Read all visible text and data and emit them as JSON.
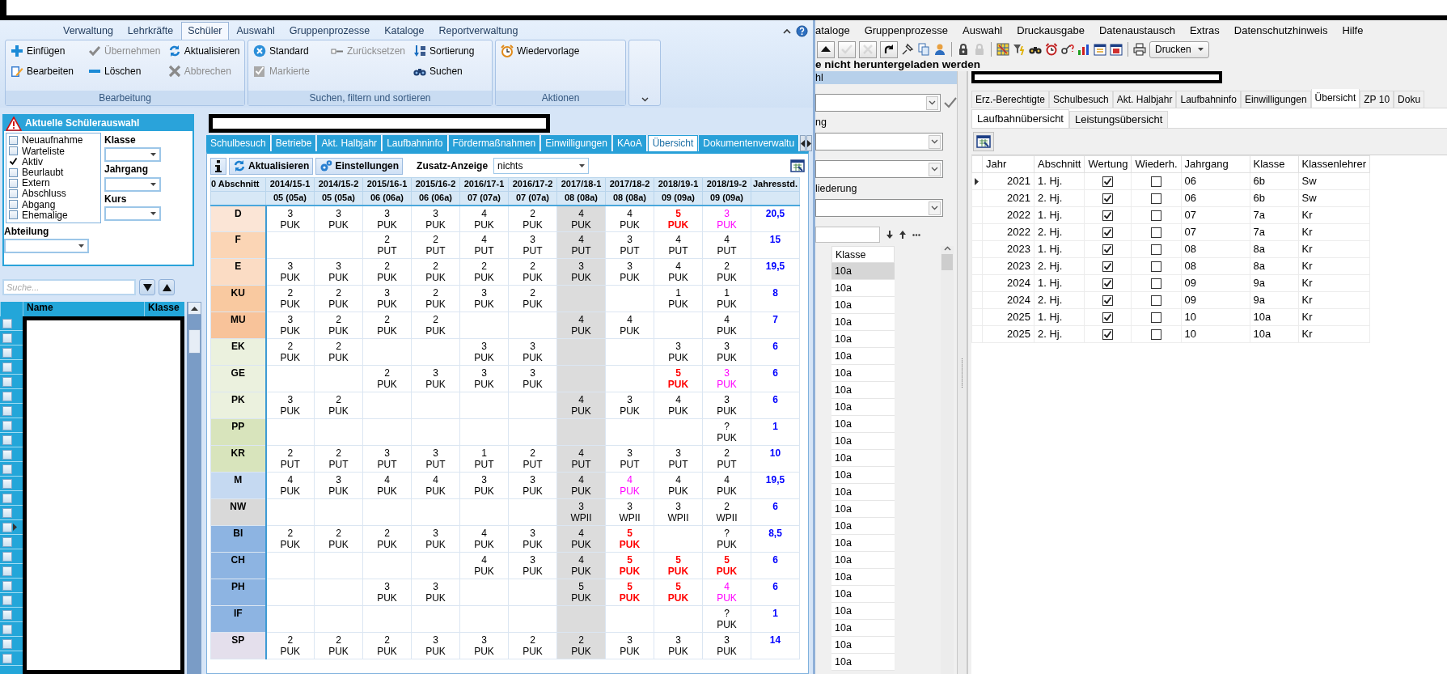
{
  "ribbon": {
    "tabs": [
      {
        "label": "Verwaltung",
        "selected": false
      },
      {
        "label": "Lehrkräfte",
        "selected": false
      },
      {
        "label": "Schüler",
        "selected": true
      },
      {
        "label": "Auswahl",
        "selected": false
      },
      {
        "label": "Gruppenprozesse",
        "selected": false
      },
      {
        "label": "Kataloge",
        "selected": false
      },
      {
        "label": "Reportverwaltung",
        "selected": false
      }
    ],
    "groups": [
      {
        "title": "Bearbeitung",
        "columns": [
          [
            {
              "label": "Einfügen",
              "disabled": false
            },
            {
              "label": "Bearbeiten",
              "disabled": false
            }
          ],
          [
            {
              "label": "Übernehmen",
              "disabled": true
            },
            {
              "label": "Löschen",
              "disabled": false
            }
          ],
          [
            {
              "label": "Aktualisieren",
              "disabled": false
            },
            {
              "label": "Abbrechen",
              "disabled": true
            }
          ]
        ]
      },
      {
        "title": "Suchen, filtern und sortieren",
        "columns": [
          [
            {
              "label": "Standard",
              "disabled": false
            },
            {
              "label": "Markierte",
              "disabled": true
            }
          ],
          [
            {
              "label": "Zurücksetzen",
              "disabled": true
            }
          ],
          [
            {
              "label": "Sortierung",
              "disabled": false
            },
            {
              "label": "Suchen",
              "disabled": false
            }
          ]
        ]
      },
      {
        "title": "Aktionen",
        "columns": [
          [
            {
              "label": "Wiedervorlage",
              "disabled": false
            }
          ]
        ]
      }
    ]
  },
  "selection_panel": {
    "title": "Aktuelle Schülerauswahl",
    "statuses": [
      {
        "label": "Neuaufnahme",
        "checked": false
      },
      {
        "label": "Warteliste",
        "checked": false
      },
      {
        "label": "Aktiv",
        "checked": true
      },
      {
        "label": "Beurlaubt",
        "checked": false
      },
      {
        "label": "Extern",
        "checked": false
      },
      {
        "label": "Abschluss",
        "checked": false
      },
      {
        "label": "Abgang",
        "checked": false
      },
      {
        "label": "Ehemalige",
        "checked": false
      }
    ],
    "filters": [
      "Klasse",
      "Jahrgang",
      "Kurs"
    ],
    "department_label": "Abteilung"
  },
  "student_search": {
    "placeholder": "Suche..."
  },
  "student_list": {
    "columns": [
      "Name",
      "Klasse"
    ],
    "rows": [
      {
        "checked": false,
        "selected": false
      },
      {
        "checked": false,
        "selected": false
      },
      {
        "checked": false,
        "selected": false
      },
      {
        "checked": false,
        "selected": false
      },
      {
        "checked": false,
        "selected": false
      },
      {
        "checked": false,
        "selected": false
      },
      {
        "checked": false,
        "selected": false
      },
      {
        "checked": false,
        "selected": false
      },
      {
        "checked": false,
        "selected": false
      },
      {
        "checked": false,
        "selected": false
      },
      {
        "checked": false,
        "selected": false
      },
      {
        "checked": false,
        "selected": false
      },
      {
        "checked": false,
        "selected": false
      },
      {
        "checked": false,
        "selected": false
      },
      {
        "checked": false,
        "selected": true
      },
      {
        "checked": false,
        "selected": false
      },
      {
        "checked": false,
        "selected": false
      },
      {
        "checked": false,
        "selected": false
      },
      {
        "checked": false,
        "selected": false
      },
      {
        "checked": false,
        "selected": false
      },
      {
        "checked": false,
        "selected": false
      },
      {
        "checked": false,
        "selected": false
      },
      {
        "checked": false,
        "selected": false
      },
      {
        "checked": false,
        "selected": false
      }
    ]
  },
  "detail_tabs": [
    {
      "label": "Schulbesuch",
      "selected": false
    },
    {
      "label": "Betriebe",
      "selected": false
    },
    {
      "label": "Akt. Halbjahr",
      "selected": false
    },
    {
      "label": "Laufbahninfo",
      "selected": false
    },
    {
      "label": "Fördermaßnahmen",
      "selected": false
    },
    {
      "label": "Einwilligungen",
      "selected": false
    },
    {
      "label": "KAoA",
      "selected": false
    },
    {
      "label": "Übersicht",
      "selected": true
    },
    {
      "label": "Dokumentenverwaltu",
      "selected": false
    }
  ],
  "overview_toolbar": {
    "buttons": [
      "Aktualisieren",
      "Einstellungen"
    ],
    "extra_label": "Zusatz-Anzeige",
    "extra_value": "nichts"
  },
  "course_grid": {
    "corner": "0 Abschnitt",
    "total_header": "Jahresstd.",
    "periods": [
      {
        "label": "2014/15-1",
        "class": "05 (05a)",
        "shaded": false
      },
      {
        "label": "2014/15-2",
        "class": "05 (05a)",
        "shaded": false
      },
      {
        "label": "2015/16-1",
        "class": "06 (06a)",
        "shaded": false
      },
      {
        "label": "2015/16-2",
        "class": "06 (06a)",
        "shaded": false
      },
      {
        "label": "2016/17-1",
        "class": "07 (07a)",
        "shaded": false
      },
      {
        "label": "2016/17-2",
        "class": "07 (07a)",
        "shaded": false
      },
      {
        "label": "2017/18-1",
        "class": "08 (08a)",
        "shaded": true
      },
      {
        "label": "2017/18-2",
        "class": "08 (08a)",
        "shaded": false
      },
      {
        "label": "2018/19-1",
        "class": "09 (09a)",
        "shaded": false
      },
      {
        "label": "2018/19-2",
        "class": "09 (09a)",
        "shaded": false
      }
    ],
    "subjects": [
      {
        "name": "D",
        "color": "#fbe5d6",
        "total": "20,5",
        "cells": [
          {
            "value": "3",
            "type": "PUK",
            "deficit": false,
            "flagged": false
          },
          {
            "value": "3",
            "type": "PUK",
            "deficit": false,
            "flagged": false
          },
          {
            "value": "3",
            "type": "PUK",
            "deficit": false,
            "flagged": false
          },
          {
            "value": "3",
            "type": "PUK",
            "deficit": false,
            "flagged": false
          },
          {
            "value": "4",
            "type": "PUK",
            "deficit": false,
            "flagged": false
          },
          {
            "value": "2",
            "type": "PUK",
            "deficit": false,
            "flagged": false
          },
          {
            "value": "4",
            "type": "PUK",
            "deficit": false,
            "flagged": false
          },
          {
            "value": "4",
            "type": "PUK",
            "deficit": false,
            "flagged": false
          },
          {
            "value": "5",
            "type": "PUK",
            "deficit": true,
            "flagged": false
          },
          {
            "value": "3",
            "type": "PUK",
            "deficit": false,
            "flagged": true
          }
        ]
      },
      {
        "name": "F",
        "color": "#fbd5b5",
        "total": "15",
        "cells": [
          null,
          null,
          {
            "value": "2",
            "type": "PUT",
            "deficit": false,
            "flagged": false
          },
          {
            "value": "2",
            "type": "PUT",
            "deficit": false,
            "flagged": false
          },
          {
            "value": "4",
            "type": "PUT",
            "deficit": false,
            "flagged": false
          },
          {
            "value": "3",
            "type": "PUT",
            "deficit": false,
            "flagged": false
          },
          {
            "value": "4",
            "type": "PUT",
            "deficit": false,
            "flagged": false
          },
          {
            "value": "3",
            "type": "PUT",
            "deficit": false,
            "flagged": false
          },
          {
            "value": "4",
            "type": "PUT",
            "deficit": false,
            "flagged": false
          },
          {
            "value": "4",
            "type": "PUT",
            "deficit": false,
            "flagged": false
          }
        ]
      },
      {
        "name": "E",
        "color": "#fbdcc4",
        "total": "19,5",
        "cells": [
          {
            "value": "3",
            "type": "PUK",
            "deficit": false,
            "flagged": false
          },
          {
            "value": "3",
            "type": "PUK",
            "deficit": false,
            "flagged": false
          },
          {
            "value": "2",
            "type": "PUK",
            "deficit": false,
            "flagged": false
          },
          {
            "value": "2",
            "type": "PUK",
            "deficit": false,
            "flagged": false
          },
          {
            "value": "2",
            "type": "PUK",
            "deficit": false,
            "flagged": false
          },
          {
            "value": "2",
            "type": "PUK",
            "deficit": false,
            "flagged": false
          },
          {
            "value": "3",
            "type": "PUK",
            "deficit": false,
            "flagged": false
          },
          {
            "value": "3",
            "type": "PUK",
            "deficit": false,
            "flagged": false
          },
          {
            "value": "4",
            "type": "PUK",
            "deficit": false,
            "flagged": false
          },
          {
            "value": "2",
            "type": "PUK",
            "deficit": false,
            "flagged": false
          }
        ]
      },
      {
        "name": "KU",
        "color": "#f9c9a0",
        "total": "8",
        "cells": [
          {
            "value": "2",
            "type": "PUK",
            "deficit": false,
            "flagged": false
          },
          {
            "value": "2",
            "type": "PUK",
            "deficit": false,
            "flagged": false
          },
          {
            "value": "3",
            "type": "PUK",
            "deficit": false,
            "flagged": false
          },
          {
            "value": "2",
            "type": "PUK",
            "deficit": false,
            "flagged": false
          },
          {
            "value": "3",
            "type": "PUK",
            "deficit": false,
            "flagged": false
          },
          {
            "value": "2",
            "type": "PUK",
            "deficit": false,
            "flagged": false
          },
          null,
          null,
          {
            "value": "1",
            "type": "PUK",
            "deficit": false,
            "flagged": false
          },
          {
            "value": "1",
            "type": "PUK",
            "deficit": false,
            "flagged": false
          }
        ]
      },
      {
        "name": "MU",
        "color": "#f8c39a",
        "total": "7",
        "cells": [
          {
            "value": "3",
            "type": "PUK",
            "deficit": false,
            "flagged": false
          },
          {
            "value": "2",
            "type": "PUK",
            "deficit": false,
            "flagged": false
          },
          {
            "value": "2",
            "type": "PUK",
            "deficit": false,
            "flagged": false
          },
          {
            "value": "2",
            "type": "PUK",
            "deficit": false,
            "flagged": false
          },
          null,
          null,
          {
            "value": "4",
            "type": "PUK",
            "deficit": false,
            "flagged": false
          },
          {
            "value": "4",
            "type": "PUK",
            "deficit": false,
            "flagged": false
          },
          null,
          {
            "value": "4",
            "type": "PUK",
            "deficit": false,
            "flagged": false
          }
        ]
      },
      {
        "name": "EK",
        "color": "#ebf1de",
        "total": "6",
        "cells": [
          {
            "value": "2",
            "type": "PUK",
            "deficit": false,
            "flagged": false
          },
          {
            "value": "2",
            "type": "PUK",
            "deficit": false,
            "flagged": false
          },
          null,
          null,
          {
            "value": "3",
            "type": "PUK",
            "deficit": false,
            "flagged": false
          },
          {
            "value": "3",
            "type": "PUK",
            "deficit": false,
            "flagged": false
          },
          null,
          null,
          {
            "value": "3",
            "type": "PUK",
            "deficit": false,
            "flagged": false
          },
          {
            "value": "3",
            "type": "PUK",
            "deficit": false,
            "flagged": false
          }
        ]
      },
      {
        "name": "GE",
        "color": "#ebf1de",
        "total": "6",
        "cells": [
          null,
          null,
          {
            "value": "2",
            "type": "PUK",
            "deficit": false,
            "flagged": false
          },
          {
            "value": "3",
            "type": "PUK",
            "deficit": false,
            "flagged": false
          },
          {
            "value": "3",
            "type": "PUK",
            "deficit": false,
            "flagged": false
          },
          {
            "value": "3",
            "type": "PUK",
            "deficit": false,
            "flagged": false
          },
          null,
          null,
          {
            "value": "5",
            "type": "PUK",
            "deficit": true,
            "flagged": false
          },
          {
            "value": "3",
            "type": "PUK",
            "deficit": false,
            "flagged": true
          }
        ]
      },
      {
        "name": "PK",
        "color": "#ebf1de",
        "total": "6",
        "cells": [
          {
            "value": "3",
            "type": "PUK",
            "deficit": false,
            "flagged": false
          },
          {
            "value": "2",
            "type": "PUK",
            "deficit": false,
            "flagged": false
          },
          null,
          null,
          null,
          null,
          {
            "value": "4",
            "type": "PUK",
            "deficit": false,
            "flagged": false
          },
          {
            "value": "3",
            "type": "PUK",
            "deficit": false,
            "flagged": false
          },
          {
            "value": "4",
            "type": "PUK",
            "deficit": false,
            "flagged": false
          },
          {
            "value": "3",
            "type": "PUK",
            "deficit": false,
            "flagged": false
          }
        ]
      },
      {
        "name": "PP",
        "color": "#d8e4bc",
        "total": "1",
        "cells": [
          null,
          null,
          null,
          null,
          null,
          null,
          null,
          null,
          null,
          {
            "value": "?",
            "type": "PUK",
            "deficit": false,
            "flagged": false
          }
        ]
      },
      {
        "name": "KR",
        "color": "#d8e4bc",
        "total": "10",
        "cells": [
          {
            "value": "2",
            "type": "PUT",
            "deficit": false,
            "flagged": false
          },
          {
            "value": "2",
            "type": "PUT",
            "deficit": false,
            "flagged": false
          },
          {
            "value": "3",
            "type": "PUT",
            "deficit": false,
            "flagged": false
          },
          {
            "value": "3",
            "type": "PUT",
            "deficit": false,
            "flagged": false
          },
          {
            "value": "1",
            "type": "PUT",
            "deficit": false,
            "flagged": false
          },
          {
            "value": "2",
            "type": "PUT",
            "deficit": false,
            "flagged": false
          },
          {
            "value": "4",
            "type": "PUT",
            "deficit": false,
            "flagged": false
          },
          {
            "value": "3",
            "type": "PUT",
            "deficit": false,
            "flagged": false
          },
          {
            "value": "3",
            "type": "PUT",
            "deficit": false,
            "flagged": false
          },
          {
            "value": "2",
            "type": "PUT",
            "deficit": false,
            "flagged": false
          }
        ]
      },
      {
        "name": "M",
        "color": "#c5d9f1",
        "total": "19,5",
        "cells": [
          {
            "value": "4",
            "type": "PUK",
            "deficit": false,
            "flagged": false
          },
          {
            "value": "3",
            "type": "PUK",
            "deficit": false,
            "flagged": false
          },
          {
            "value": "4",
            "type": "PUK",
            "deficit": false,
            "flagged": false
          },
          {
            "value": "4",
            "type": "PUK",
            "deficit": false,
            "flagged": false
          },
          {
            "value": "3",
            "type": "PUK",
            "deficit": false,
            "flagged": false
          },
          {
            "value": "3",
            "type": "PUK",
            "deficit": false,
            "flagged": false
          },
          {
            "value": "4",
            "type": "PUK",
            "deficit": false,
            "flagged": false
          },
          {
            "value": "4",
            "type": "PUK",
            "deficit": false,
            "flagged": true
          },
          {
            "value": "4",
            "type": "PUK",
            "deficit": false,
            "flagged": false
          },
          {
            "value": "4",
            "type": "PUK",
            "deficit": false,
            "flagged": false
          }
        ]
      },
      {
        "name": "NW",
        "color": "#d9d9d9",
        "total": "6",
        "cells": [
          null,
          null,
          null,
          null,
          null,
          null,
          {
            "value": "3",
            "type": "WPII",
            "deficit": false,
            "flagged": false
          },
          {
            "value": "3",
            "type": "WPII",
            "deficit": false,
            "flagged": false
          },
          {
            "value": "3",
            "type": "WPII",
            "deficit": false,
            "flagged": false
          },
          {
            "value": "2",
            "type": "WPII",
            "deficit": false,
            "flagged": false
          }
        ]
      },
      {
        "name": "BI",
        "color": "#8db4e2",
        "total": "8,5",
        "cells": [
          {
            "value": "2",
            "type": "PUK",
            "deficit": false,
            "flagged": false
          },
          {
            "value": "2",
            "type": "PUK",
            "deficit": false,
            "flagged": false
          },
          {
            "value": "2",
            "type": "PUK",
            "deficit": false,
            "flagged": false
          },
          {
            "value": "3",
            "type": "PUK",
            "deficit": false,
            "flagged": false
          },
          {
            "value": "4",
            "type": "PUK",
            "deficit": false,
            "flagged": false
          },
          {
            "value": "3",
            "type": "PUK",
            "deficit": false,
            "flagged": false
          },
          {
            "value": "4",
            "type": "PUK",
            "deficit": false,
            "flagged": false
          },
          {
            "value": "5",
            "type": "PUK",
            "deficit": true,
            "flagged": false
          },
          null,
          {
            "value": "?",
            "type": "PUK",
            "deficit": false,
            "flagged": false
          }
        ]
      },
      {
        "name": "CH",
        "color": "#8db4e2",
        "total": "6",
        "cells": [
          null,
          null,
          null,
          null,
          {
            "value": "4",
            "type": "PUK",
            "deficit": false,
            "flagged": false
          },
          {
            "value": "3",
            "type": "PUK",
            "deficit": false,
            "flagged": false
          },
          {
            "value": "4",
            "type": "PUK",
            "deficit": false,
            "flagged": false
          },
          {
            "value": "5",
            "type": "PUK",
            "deficit": true,
            "flagged": false
          },
          {
            "value": "5",
            "type": "PUK",
            "deficit": true,
            "flagged": false
          },
          {
            "value": "5",
            "type": "PUK",
            "deficit": true,
            "flagged": false
          }
        ]
      },
      {
        "name": "PH",
        "color": "#8db4e2",
        "total": "6",
        "cells": [
          null,
          null,
          {
            "value": "3",
            "type": "PUK",
            "deficit": false,
            "flagged": false
          },
          {
            "value": "3",
            "type": "PUK",
            "deficit": false,
            "flagged": false
          },
          null,
          null,
          {
            "value": "5",
            "type": "PUK",
            "deficit": false,
            "flagged": false
          },
          {
            "value": "5",
            "type": "PUK",
            "deficit": true,
            "flagged": false
          },
          {
            "value": "5",
            "type": "PUK",
            "deficit": true,
            "flagged": false
          },
          {
            "value": "4",
            "type": "PUK",
            "deficit": false,
            "flagged": true
          }
        ]
      },
      {
        "name": "IF",
        "color": "#8db4e2",
        "total": "1",
        "cells": [
          null,
          null,
          null,
          null,
          null,
          null,
          null,
          null,
          null,
          {
            "value": "?",
            "type": "PUK",
            "deficit": false,
            "flagged": false
          }
        ]
      },
      {
        "name": "SP",
        "color": "#e4dfec",
        "total": "14",
        "cells": [
          {
            "value": "2",
            "type": "PUK",
            "deficit": false,
            "flagged": false
          },
          {
            "value": "2",
            "type": "PUK",
            "deficit": false,
            "flagged": false
          },
          {
            "value": "2",
            "type": "PUK",
            "deficit": false,
            "flagged": false
          },
          {
            "value": "3",
            "type": "PUK",
            "deficit": false,
            "flagged": false
          },
          {
            "value": "3",
            "type": "PUK",
            "deficit": false,
            "flagged": false
          },
          {
            "value": "2",
            "type": "PUK",
            "deficit": false,
            "flagged": false
          },
          {
            "value": "2",
            "type": "PUK",
            "deficit": false,
            "flagged": false
          },
          {
            "value": "3",
            "type": "PUK",
            "deficit": false,
            "flagged": false
          },
          {
            "value": "3",
            "type": "PUK",
            "deficit": false,
            "flagged": false
          },
          {
            "value": "3",
            "type": "PUK",
            "deficit": false,
            "flagged": false
          }
        ]
      }
    ]
  },
  "app_menu": [
    "ataloge",
    "Gruppenprozesse",
    "Auswahl",
    "Druckausgabe",
    "Datenaustausch",
    "Extras",
    "Datenschutzhinweis",
    "Hilfe"
  ],
  "app_toolbar": {
    "buttons": [
      {
        "disabled": false
      },
      {
        "disabled": true
      },
      {
        "disabled": true
      },
      {
        "disabled": false
      },
      {
        "disabled": false
      },
      {
        "disabled": false
      },
      {
        "disabled": false
      },
      {
        "disabled": false
      },
      {
        "disabled": true
      },
      {
        "disabled": false
      },
      {
        "disabled": false
      },
      {
        "disabled": false
      },
      {
        "disabled": false
      },
      {
        "disabled": false
      },
      {
        "disabled": false
      },
      {
        "disabled": false
      },
      {
        "disabled": false
      },
      {
        "disabled": false
      }
    ],
    "print_button": "Drucken"
  },
  "notice": "e nicht heruntergeladen werden",
  "side_panel": {
    "header": "hl",
    "fields": [
      {
        "checkmark": true
      },
      {
        "label": "ng",
        "checkmark": false
      },
      {
        "checkmark": false
      },
      {
        "label": "liederung",
        "checkmark": false
      }
    ],
    "list_header": "Klasse",
    "rows": [
      {
        "value": "10a",
        "selected": true
      },
      {
        "value": "10a",
        "selected": false
      },
      {
        "value": "10a",
        "selected": false
      },
      {
        "value": "10a",
        "selected": false
      },
      {
        "value": "10a",
        "selected": false
      },
      {
        "value": "10a",
        "selected": false
      },
      {
        "value": "10a",
        "selected": false
      },
      {
        "value": "10a",
        "selected": false
      },
      {
        "value": "10a",
        "selected": false
      },
      {
        "value": "10a",
        "selected": false
      },
      {
        "value": "10a",
        "selected": false
      },
      {
        "value": "10a",
        "selected": false
      },
      {
        "value": "10a",
        "selected": false
      },
      {
        "value": "10a",
        "selected": false
      },
      {
        "value": "10a",
        "selected": false
      },
      {
        "value": "10a",
        "selected": false
      },
      {
        "value": "10a",
        "selected": false
      },
      {
        "value": "10a",
        "selected": false
      },
      {
        "value": "10a",
        "selected": false
      },
      {
        "value": "10a",
        "selected": false
      },
      {
        "value": "10a",
        "selected": false
      },
      {
        "value": "10a",
        "selected": false
      },
      {
        "value": "10a",
        "selected": false
      },
      {
        "value": "10a",
        "selected": false
      }
    ]
  },
  "record_tabs": [
    {
      "label": "Erz.-Berechtigte",
      "selected": false
    },
    {
      "label": "Schulbesuch",
      "selected": false
    },
    {
      "label": "Akt. Halbjahr",
      "selected": false
    },
    {
      "label": "Laufbahninfo",
      "selected": false
    },
    {
      "label": "Einwilligungen",
      "selected": false
    },
    {
      "label": "Übersicht",
      "selected": true
    },
    {
      "label": "ZP 10",
      "selected": false
    },
    {
      "label": "Doku",
      "selected": false
    }
  ],
  "record_subtabs": [
    {
      "label": "Laufbahnübersicht",
      "selected": true
    },
    {
      "label": "Leistungsübersicht",
      "selected": false
    }
  ],
  "history_table": {
    "columns": [
      "Jahr",
      "Abschnitt",
      "Wertung",
      "Wiederh.",
      "Jahrgang",
      "Klasse",
      "Klassenlehrer"
    ],
    "rows": [
      {
        "year": "2021",
        "term": "1. Hj.",
        "counted": true,
        "repeated": false,
        "grade_level": "06",
        "class": "6b",
        "teacher": "Sw",
        "selected": true
      },
      {
        "year": "2021",
        "term": "2. Hj.",
        "counted": true,
        "repeated": false,
        "grade_level": "06",
        "class": "6b",
        "teacher": "Sw",
        "selected": false
      },
      {
        "year": "2022",
        "term": "1. Hj.",
        "counted": true,
        "repeated": false,
        "grade_level": "07",
        "class": "7a",
        "teacher": "Kr",
        "selected": false
      },
      {
        "year": "2022",
        "term": "2. Hj.",
        "counted": true,
        "repeated": false,
        "grade_level": "07",
        "class": "7a",
        "teacher": "Kr",
        "selected": false
      },
      {
        "year": "2023",
        "term": "1. Hj.",
        "counted": true,
        "repeated": false,
        "grade_level": "08",
        "class": "8a",
        "teacher": "Kr",
        "selected": false
      },
      {
        "year": "2023",
        "term": "2. Hj.",
        "counted": true,
        "repeated": false,
        "grade_level": "08",
        "class": "8a",
        "teacher": "Kr",
        "selected": false
      },
      {
        "year": "2024",
        "term": "1. Hj.",
        "counted": true,
        "repeated": false,
        "grade_level": "09",
        "class": "9a",
        "teacher": "Kr",
        "selected": false
      },
      {
        "year": "2024",
        "term": "2. Hj.",
        "counted": true,
        "repeated": false,
        "grade_level": "09",
        "class": "9a",
        "teacher": "Kr",
        "selected": false
      },
      {
        "year": "2025",
        "term": "1. Hj.",
        "counted": true,
        "repeated": false,
        "grade_level": "10",
        "class": "10a",
        "teacher": "Kr",
        "selected": false
      },
      {
        "year": "2025",
        "term": "2. Hj.",
        "counted": true,
        "repeated": false,
        "grade_level": "10",
        "class": "10a",
        "teacher": "Kr",
        "selected": false
      }
    ]
  }
}
